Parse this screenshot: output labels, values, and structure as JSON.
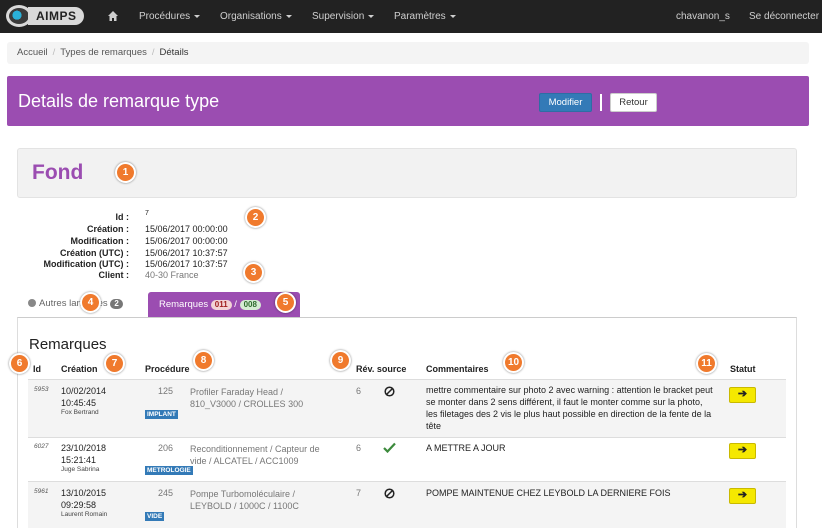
{
  "navbar": {
    "brand": "AIMPS",
    "menus": [
      "Procédures",
      "Organisations",
      "Supervision",
      "Paramètres"
    ],
    "user": "chavanon_s",
    "logout": "Se déconnecter"
  },
  "breadcrumb": [
    "Accueil",
    "Types de remarques",
    "Détails"
  ],
  "header": {
    "title": "Details de remarque type",
    "modify": "Modifier",
    "back": "Retour"
  },
  "remark_type": {
    "name": "Fond",
    "fields": [
      {
        "label": "Id :",
        "value": "7"
      },
      {
        "label": "Création :",
        "value": "15/06/2017 00:00:00"
      },
      {
        "label": "Modification :",
        "value": "15/06/2017 00:00:00"
      },
      {
        "label": "Création (UTC) :",
        "value": "15/06/2017 10:37:57"
      },
      {
        "label": "Modification (UTC) :",
        "value": "15/06/2017 10:37:57"
      },
      {
        "label": "Client :",
        "value": "40-30 France"
      }
    ]
  },
  "tabs": {
    "other": {
      "label": "Autres langages",
      "count": "2"
    },
    "remarks": {
      "label": "Remarques",
      "count_a": "011",
      "sep": "/",
      "count_b": "008"
    }
  },
  "remarks": {
    "title": "Remarques",
    "columns": [
      "Id",
      "Création",
      "Procédure",
      "Rév. source",
      "Commentaires",
      "Statut"
    ],
    "rows": [
      {
        "id": "5953",
        "date": "10/02/2014",
        "time": "10:45:45",
        "author": "Fox Bertrand",
        "proc_num": "125",
        "procedure": "Profiler Faraday Head / 810_V3000 / CROLLES 300",
        "tag": "IMPLANT",
        "rev": "6",
        "source_icon": "forbidden-icon",
        "comment": "mettre commentaire sur photo 2 avec warning : attention le bracket peut se monter dans 2 sens différent, il faut le monter comme sur la photo, les filetages des 2 vis le plus haut possible en direction de la fente de la tête"
      },
      {
        "id": "6027",
        "date": "23/10/2018",
        "time": "15:21:41",
        "author": "Juge Sabrina",
        "proc_num": "206",
        "procedure": "Reconditionnement / Capteur de vide / ALCATEL / ACC1009",
        "tag": "METROLOGIE",
        "rev": "6",
        "source_icon": "check-icon",
        "comment": "A METTRE A JOUR"
      },
      {
        "id": "5961",
        "date": "13/10/2015",
        "time": "09:29:58",
        "author": "Laurent Romain",
        "proc_num": "245",
        "procedure": "Pompe Turbomoléculaire / LEYBOLD / 1000C / 1100C",
        "tag": "VIDE",
        "rev": "7",
        "source_icon": "forbidden-icon",
        "comment": "POMPE MAINTENUE CHEZ LEYBOLD LA DERNIERE FOIS"
      }
    ]
  },
  "markers": [
    "1",
    "2",
    "3",
    "4",
    "5",
    "6",
    "7",
    "8",
    "9",
    "10",
    "11"
  ],
  "colors": {
    "purple": "#9b4db1",
    "blue": "#337ab7",
    "yellow": "#f5e800",
    "marker": "#f07a2d"
  }
}
